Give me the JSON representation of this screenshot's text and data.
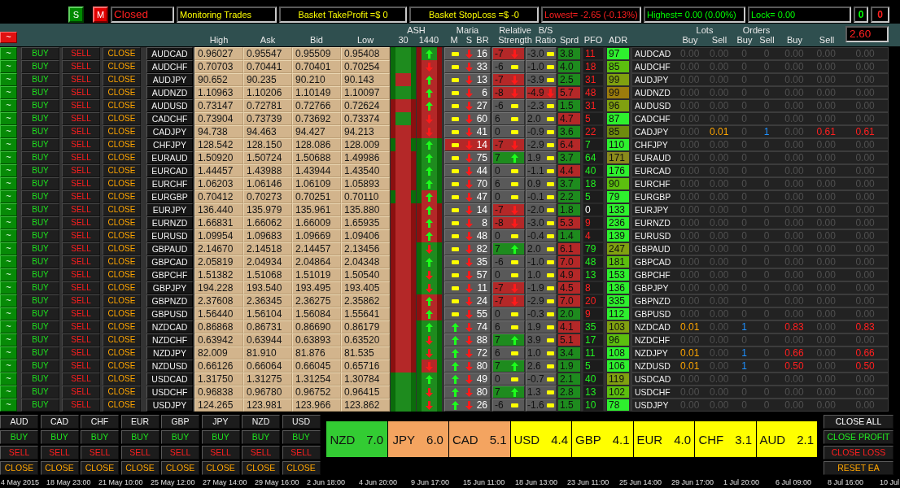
{
  "top_bar": {
    "buttons": [
      {
        "label": "S",
        "on": true
      },
      {
        "label": "M",
        "on": false
      }
    ],
    "fields": [
      {
        "text": "Closed",
        "color": "#ff2020"
      },
      {
        "text": "Monitoring Trades",
        "color": "#ffff00"
      },
      {
        "text": "Basket TakeProfit =$ 0",
        "color": "#ffff00"
      },
      {
        "text": "Basket StopLoss =$ -0",
        "color": "#ffff00"
      },
      {
        "text": "Lowest= -2.65 (-0.13%)",
        "color": "#ff2020"
      },
      {
        "text": "Highest= 0.00 (0.00%)",
        "color": "#00ff00"
      },
      {
        "text": "Lock= 0.00",
        "color": "#00ff00"
      },
      {
        "text": "0",
        "color": "#00ff00"
      },
      {
        "text": "0",
        "color": "#ff2020"
      }
    ]
  },
  "header": {
    "toggle": "~",
    "toggle_on": false,
    "columns": [
      {
        "label": "High"
      },
      {
        "label": "Ask"
      },
      {
        "label": "Bid"
      },
      {
        "label": "Low"
      },
      {
        "group": "ASH",
        "labels": [
          "30",
          "1440"
        ]
      },
      {
        "group": "Maria",
        "labels": [
          "M",
          "S",
          "BR"
        ]
      },
      {
        "group": "Relative",
        "labels": [
          "Strength"
        ]
      },
      {
        "group": "B/S",
        "labels": [
          "Ratio"
        ]
      },
      {
        "label": "Sprd"
      },
      {
        "label": "PFO"
      },
      {
        "label": "ADR"
      },
      {
        "group": "Lots",
        "labels": [
          "Buy",
          "Sell"
        ]
      },
      {
        "group": "Orders",
        "labels": [
          "Buy",
          "Sell"
        ]
      },
      {
        "label": "Buy"
      },
      {
        "label": "Sell"
      }
    ],
    "value": "2.60"
  },
  "rows": [
    {
      "toggle": "~",
      "toggle_on": true,
      "buy": "BUY",
      "sell": "SELL",
      "close": "CLOSE",
      "symbol": "AUDCAD",
      "high": "0.96027",
      "ask": "0.95547",
      "bid": "0.95509",
      "low": "0.95408",
      "ash_30": {
        "color": "#1e8b1e",
        "frame": {
          "color": "#0b6b0b"
        }
      },
      "ash_1440": {
        "color": "#1e8b1e",
        "up": true,
        "frame": {
          "color": "#8a1010"
        }
      },
      "maria": {
        "m_up": false,
        "s_up": false,
        "br": "16",
        "alert": false
      },
      "rs": {
        "value": "-7",
        "up": false,
        "down": true
      },
      "bs": {
        "value": "-3.0",
        "up": false,
        "down": false
      },
      "sprd": {
        "value": "3.8",
        "color": "#1e8b1e"
      },
      "pfo": {
        "value": "11",
        "color": "#ff2020"
      },
      "adr": {
        "value": "97",
        "color": "#2ef02e"
      },
      "trades": {
        "symbol": "AUDCAD",
        "cells": [
          "0.00",
          "0.00",
          "0",
          "0",
          "0.00",
          "0.00",
          "0.00"
        ],
        "buy_open": false,
        "sell_open": false
      }
    },
    {
      "toggle": "~",
      "toggle_on": true,
      "buy": "BUY",
      "sell": "SELL",
      "close": "CLOSE",
      "symbol": "AUDCHF",
      "high": "0.70703",
      "ask": "0.70441",
      "bid": "0.70401",
      "low": "0.70254",
      "ash_30": {
        "color": "#1e8b1e",
        "frame": {
          "color": "#0b6b0b"
        }
      },
      "ash_1440": {
        "color": "#b42828",
        "up": false,
        "frame": {
          "color": "#8a1010"
        }
      },
      "maria": {
        "m_up": false,
        "s_up": false,
        "br": "33",
        "alert": false
      },
      "rs": {
        "value": "-6",
        "up": false,
        "down": false
      },
      "bs": {
        "value": "-1.0",
        "up": false,
        "down": false
      },
      "sprd": {
        "value": "4.0",
        "color": "#1e8b1e"
      },
      "pfo": {
        "value": "18",
        "color": "#ff2020"
      },
      "adr": {
        "value": "85",
        "color": "#5cbf0f"
      },
      "trades": {
        "symbol": "AUDCHF",
        "cells": [
          "0.00",
          "0.00",
          "0",
          "0",
          "0.00",
          "0.00",
          "0.00"
        ],
        "buy_open": false,
        "sell_open": false
      }
    },
    {
      "toggle": "~",
      "toggle_on": true,
      "buy": "BUY",
      "sell": "SELL",
      "close": "CLOSE",
      "symbol": "AUDJPY",
      "high": "90.652",
      "ask": "90.235",
      "bid": "90.210",
      "low": "90.143",
      "ash_30": {
        "color": "#b42828",
        "frame": {
          "color": "#0b6b0b"
        }
      },
      "ash_1440": {
        "color": "#b42828",
        "up": true,
        "frame": {
          "color": "#8a1010"
        }
      },
      "maria": {
        "m_up": false,
        "s_up": false,
        "br": "13",
        "alert": false
      },
      "rs": {
        "value": "-7",
        "up": false,
        "down": true
      },
      "bs": {
        "value": "-3.9",
        "up": false,
        "down": false
      },
      "sprd": {
        "value": "2.5",
        "color": "#1e8b1e"
      },
      "pfo": {
        "value": "31",
        "color": "#ff2020"
      },
      "adr": {
        "value": "99",
        "color": "#80a010"
      },
      "trades": {
        "symbol": "AUDJPY",
        "cells": [
          "0.00",
          "0.00",
          "0",
          "0",
          "0.00",
          "0.00",
          "0.00"
        ],
        "buy_open": false,
        "sell_open": false
      }
    },
    {
      "toggle": "~",
      "toggle_on": true,
      "buy": "BUY",
      "sell": "SELL",
      "close": "CLOSE",
      "symbol": "AUDNZD",
      "high": "1.10963",
      "ask": "1.10206",
      "bid": "1.10149",
      "low": "1.10097",
      "ash_30": {
        "color": "#1e8b1e",
        "frame": {
          "color": "#0b6b0b"
        }
      },
      "ash_1440": {
        "color": "#b42828",
        "up": true,
        "frame": {
          "color": "#8a1010"
        }
      },
      "maria": {
        "m_up": false,
        "s_up": false,
        "br": "6",
        "alert": false
      },
      "rs": {
        "value": "-8",
        "up": false,
        "down": true
      },
      "bs": {
        "value": "-4.9",
        "up": false,
        "down": true
      },
      "sprd": {
        "value": "5.7",
        "color": "#b42828"
      },
      "pfo": {
        "value": "48",
        "color": "#ff2020"
      },
      "adr": {
        "value": "99",
        "color": "#9c7c0c"
      },
      "trades": {
        "symbol": "AUDNZD",
        "cells": [
          "0.00",
          "0.00",
          "0",
          "0",
          "0.00",
          "0.00",
          "0.00"
        ],
        "buy_open": false,
        "sell_open": false
      }
    },
    {
      "toggle": "~",
      "toggle_on": true,
      "buy": "BUY",
      "sell": "SELL",
      "close": "CLOSE",
      "symbol": "AUDUSD",
      "high": "0.73147",
      "ask": "0.72781",
      "bid": "0.72766",
      "low": "0.72624",
      "ash_30": {
        "color": "#b42828",
        "frame": {
          "color": "#8a1010"
        }
      },
      "ash_1440": {
        "color": "#b42828",
        "up": true,
        "frame": {
          "color": "#8a1010"
        }
      },
      "maria": {
        "m_up": false,
        "s_up": false,
        "br": "27",
        "alert": false
      },
      "rs": {
        "value": "-6",
        "up": false,
        "down": false
      },
      "bs": {
        "value": "-2.3",
        "up": false,
        "down": false
      },
      "sprd": {
        "value": "1.5",
        "color": "#1e8b1e"
      },
      "pfo": {
        "value": "31",
        "color": "#ff2020"
      },
      "adr": {
        "value": "96",
        "color": "#80a010"
      },
      "trades": {
        "symbol": "AUDUSD",
        "cells": [
          "0.00",
          "0.00",
          "0",
          "0",
          "0.00",
          "0.00",
          "0.00"
        ],
        "buy_open": false,
        "sell_open": false
      }
    },
    {
      "toggle": "~",
      "toggle_on": true,
      "buy": "BUY",
      "sell": "SELL",
      "close": "CLOSE",
      "symbol": "CADCHF",
      "high": "0.73904",
      "ask": "0.73739",
      "bid": "0.73692",
      "low": "0.73374",
      "ash_30": {
        "color": "#1e8b1e",
        "frame": {
          "color": "#8a1010"
        }
      },
      "ash_1440": {
        "color": "#b42828",
        "up": false,
        "frame": {
          "color": "#8a1010"
        }
      },
      "maria": {
        "m_up": false,
        "s_up": false,
        "br": "60",
        "alert": false
      },
      "rs": {
        "value": "6",
        "up": false,
        "down": false
      },
      "bs": {
        "value": "2.0",
        "up": false,
        "down": false
      },
      "sprd": {
        "value": "4.7",
        "color": "#b42828"
      },
      "pfo": {
        "value": "5",
        "color": "#ff2020"
      },
      "adr": {
        "value": "87",
        "color": "#2ef02e"
      },
      "trades": {
        "symbol": "CADCHF",
        "cells": [
          "0.00",
          "0.00",
          "0",
          "0",
          "0.00",
          "0.00",
          "0.00"
        ],
        "buy_open": false,
        "sell_open": false
      }
    },
    {
      "toggle": "~",
      "toggle_on": true,
      "buy": "BUY",
      "sell": "SELL",
      "close": "CLOSE",
      "symbol": "CADJPY",
      "high": "94.738",
      "ask": "94.463",
      "bid": "94.427",
      "low": "94.213",
      "ash_30": {
        "color": "#b42828",
        "frame": {
          "color": "#8a1010"
        }
      },
      "ash_1440": {
        "color": "#b42828",
        "up": false,
        "frame": {
          "color": "#8a1010"
        }
      },
      "maria": {
        "m_up": false,
        "s_up": false,
        "br": "41",
        "alert": false
      },
      "rs": {
        "value": "0",
        "up": false,
        "down": false
      },
      "bs": {
        "value": "-0.9",
        "up": false,
        "down": false
      },
      "sprd": {
        "value": "3.6",
        "color": "#1e8b1e"
      },
      "pfo": {
        "value": "22",
        "color": "#ff2020"
      },
      "adr": {
        "value": "85",
        "color": "#6e8c0e"
      },
      "trades": {
        "symbol": "CADJPY",
        "cells": [
          "0.00",
          "0.01",
          "0",
          "1",
          "0.00",
          "0.61",
          "0.61"
        ],
        "buy_open": false,
        "sell_open": true
      }
    },
    {
      "toggle": "~",
      "toggle_on": true,
      "buy": "BUY",
      "sell": "SELL",
      "close": "CLOSE",
      "symbol": "CHFJPY",
      "high": "128.542",
      "ask": "128.150",
      "bid": "128.086",
      "low": "128.009",
      "ash_30": {
        "color": "#b42828",
        "frame": {
          "color": "#0b6b0b"
        }
      },
      "ash_1440": {
        "color": "#1e8b1e",
        "up": true,
        "frame": {
          "color": "#0b6b0b"
        }
      },
      "maria": {
        "m_up": false,
        "s_up": false,
        "br": "14",
        "alert": true
      },
      "rs": {
        "value": "-7",
        "up": false,
        "down": true
      },
      "bs": {
        "value": "-2.9",
        "up": false,
        "down": false
      },
      "sprd": {
        "value": "6.4",
        "color": "#b42828"
      },
      "pfo": {
        "value": "7",
        "color": "#22ee22"
      },
      "adr": {
        "value": "110",
        "color": "#2ef02e"
      },
      "trades": {
        "symbol": "CHFJPY",
        "cells": [
          "0.00",
          "0.00",
          "0",
          "0",
          "0.00",
          "0.00",
          "0.00"
        ],
        "buy_open": false,
        "sell_open": false
      }
    },
    {
      "toggle": "~",
      "toggle_on": true,
      "buy": "BUY",
      "sell": "SELL",
      "close": "CLOSE",
      "symbol": "EURAUD",
      "high": "1.50920",
      "ask": "1.50724",
      "bid": "1.50688",
      "low": "1.49986",
      "ash_30": {
        "color": "#b42828",
        "frame": {
          "color": "#8a1010"
        }
      },
      "ash_1440": {
        "color": "#1e8b1e",
        "up": true,
        "frame": {
          "color": "#0b6b0b"
        }
      },
      "maria": {
        "m_up": false,
        "s_up": false,
        "br": "75",
        "alert": false
      },
      "rs": {
        "value": "7",
        "up": true,
        "down": false
      },
      "bs": {
        "value": "1.9",
        "up": false,
        "down": false
      },
      "sprd": {
        "value": "3.7",
        "color": "#1e8b1e"
      },
      "pfo": {
        "value": "64",
        "color": "#22ee22"
      },
      "adr": {
        "value": "171",
        "color": "#8a8a1c"
      },
      "trades": {
        "symbol": "EURAUD",
        "cells": [
          "0.00",
          "0.00",
          "0",
          "0",
          "0.00",
          "0.00",
          "0.00"
        ],
        "buy_open": false,
        "sell_open": false
      }
    },
    {
      "toggle": "~",
      "toggle_on": true,
      "buy": "BUY",
      "sell": "SELL",
      "close": "CLOSE",
      "symbol": "EURCAD",
      "high": "1.44457",
      "ask": "1.43988",
      "bid": "1.43944",
      "low": "1.43540",
      "ash_30": {
        "color": "#b42828",
        "frame": {
          "color": "#8a1010"
        }
      },
      "ash_1440": {
        "color": "#1e8b1e",
        "up": true,
        "frame": {
          "color": "#0b6b0b"
        }
      },
      "maria": {
        "m_up": false,
        "s_up": false,
        "br": "44",
        "alert": false
      },
      "rs": {
        "value": "0",
        "up": false,
        "down": false
      },
      "bs": {
        "value": "-1.1",
        "up": false,
        "down": false
      },
      "sprd": {
        "value": "4.4",
        "color": "#b42828"
      },
      "pfo": {
        "value": "40",
        "color": "#22ee22"
      },
      "adr": {
        "value": "176",
        "color": "#2ef02e"
      },
      "trades": {
        "symbol": "EURCAD",
        "cells": [
          "0.00",
          "0.00",
          "0",
          "0",
          "0.00",
          "0.00",
          "0.00"
        ],
        "buy_open": false,
        "sell_open": false
      }
    },
    {
      "toggle": "~",
      "toggle_on": true,
      "buy": "BUY",
      "sell": "SELL",
      "close": "CLOSE",
      "symbol": "EURCHF",
      "high": "1.06203",
      "ask": "1.06146",
      "bid": "1.06109",
      "low": "1.05893",
      "ash_30": {
        "color": "#b42828",
        "frame": {
          "color": "#8a1010"
        }
      },
      "ash_1440": {
        "color": "#1e8b1e",
        "up": true,
        "frame": {
          "color": "#0b6b0b"
        }
      },
      "maria": {
        "m_up": false,
        "s_up": false,
        "br": "70",
        "alert": false
      },
      "rs": {
        "value": "6",
        "up": false,
        "down": false
      },
      "bs": {
        "value": "0.9",
        "up": false,
        "down": false
      },
      "sprd": {
        "value": "3.7",
        "color": "#1e8b1e"
      },
      "pfo": {
        "value": "18",
        "color": "#22ee22"
      },
      "adr": {
        "value": "90",
        "color": "#5cbf0f"
      },
      "trades": {
        "symbol": "EURCHF",
        "cells": [
          "0.00",
          "0.00",
          "0",
          "0",
          "0.00",
          "0.00",
          "0.00"
        ],
        "buy_open": false,
        "sell_open": false
      }
    },
    {
      "toggle": "~",
      "toggle_on": true,
      "buy": "BUY",
      "sell": "SELL",
      "close": "CLOSE",
      "symbol": "EURGBP",
      "high": "0.70412",
      "ask": "0.70273",
      "bid": "0.70251",
      "low": "0.70110",
      "ash_30": {
        "color": "#b42828",
        "frame": {
          "color": "#0b6b0b"
        }
      },
      "ash_1440": {
        "color": "#b42828",
        "up": true,
        "frame": {
          "color": "#0b6b0b"
        }
      },
      "maria": {
        "m_up": false,
        "s_up": false,
        "br": "47",
        "alert": false
      },
      "rs": {
        "value": "0",
        "up": false,
        "down": false
      },
      "bs": {
        "value": "-0.1",
        "up": false,
        "down": false
      },
      "sprd": {
        "value": "2.2",
        "color": "#1e8b1e"
      },
      "pfo": {
        "value": "5",
        "color": "#22ee22"
      },
      "adr": {
        "value": "79",
        "color": "#2ef02e"
      },
      "trades": {
        "symbol": "EURGBP",
        "cells": [
          "0.00",
          "0.00",
          "0",
          "0",
          "0.00",
          "0.00",
          "0.00"
        ],
        "buy_open": false,
        "sell_open": false
      }
    },
    {
      "toggle": "~",
      "toggle_on": true,
      "buy": "BUY",
      "sell": "SELL",
      "close": "CLOSE",
      "symbol": "EURJPY",
      "high": "136.440",
      "ask": "135.979",
      "bid": "135.961",
      "low": "135.880",
      "ash_30": {
        "color": "#b42828",
        "frame": {
          "color": "#8a1010"
        }
      },
      "ash_1440": {
        "color": "#b42828",
        "up": true,
        "frame": {
          "color": "#8a1010"
        }
      },
      "maria": {
        "m_up": false,
        "s_up": false,
        "br": "14",
        "alert": false
      },
      "rs": {
        "value": "-7",
        "up": false,
        "down": true
      },
      "bs": {
        "value": "-2.0",
        "up": false,
        "down": false
      },
      "sprd": {
        "value": "1.8",
        "color": "#1e8b1e"
      },
      "pfo": {
        "value": "0",
        "color": "#ffffff"
      },
      "adr": {
        "value": "133",
        "color": "#2ef02e"
      },
      "trades": {
        "symbol": "EURJPY",
        "cells": [
          "0.00",
          "0.00",
          "0",
          "0",
          "0.00",
          "0.00",
          "0.00"
        ],
        "buy_open": false,
        "sell_open": false
      }
    },
    {
      "toggle": "~",
      "toggle_on": true,
      "buy": "BUY",
      "sell": "SELL",
      "close": "CLOSE",
      "symbol": "EURNZD",
      "high": "1.66831",
      "ask": "1.66062",
      "bid": "1.66009",
      "low": "1.65935",
      "ash_30": {
        "color": "#b42828",
        "frame": {
          "color": "#8a1010"
        }
      },
      "ash_1440": {
        "color": "#b42828",
        "up": true,
        "frame": {
          "color": "#8a1010"
        }
      },
      "maria": {
        "m_up": false,
        "s_up": false,
        "br": "8",
        "alert": false
      },
      "rs": {
        "value": "-8",
        "up": false,
        "down": true
      },
      "bs": {
        "value": "-3.0",
        "up": false,
        "down": false
      },
      "sprd": {
        "value": "5.3",
        "color": "#b42828"
      },
      "pfo": {
        "value": "9",
        "color": "#ff2020"
      },
      "adr": {
        "value": "236",
        "color": "#2ef02e"
      },
      "trades": {
        "symbol": "EURNZD",
        "cells": [
          "0.00",
          "0.00",
          "0",
          "0",
          "0.00",
          "0.00",
          "0.00"
        ],
        "buy_open": false,
        "sell_open": false
      }
    },
    {
      "toggle": "~",
      "toggle_on": true,
      "buy": "BUY",
      "sell": "SELL",
      "close": "CLOSE",
      "symbol": "EURUSD",
      "high": "1.09954",
      "ask": "1.09683",
      "bid": "1.09669",
      "low": "1.09406",
      "ash_30": {
        "color": "#b42828",
        "frame": {
          "color": "#8a1010"
        }
      },
      "ash_1440": {
        "color": "#b42828",
        "up": true,
        "frame": {
          "color": "#8a1010"
        }
      },
      "maria": {
        "m_up": false,
        "s_up": false,
        "br": "48",
        "alert": false
      },
      "rs": {
        "value": "0",
        "up": false,
        "down": false
      },
      "bs": {
        "value": "-0.4",
        "up": false,
        "down": false
      },
      "sprd": {
        "value": "1.4",
        "color": "#1e8b1e"
      },
      "pfo": {
        "value": "4",
        "color": "#ff2020"
      },
      "adr": {
        "value": "139",
        "color": "#2ef02e"
      },
      "trades": {
        "symbol": "EURUSD",
        "cells": [
          "0.00",
          "0.00",
          "0",
          "0",
          "0.00",
          "0.00",
          "0.00"
        ],
        "buy_open": false,
        "sell_open": false
      }
    },
    {
      "toggle": "~",
      "toggle_on": true,
      "buy": "BUY",
      "sell": "SELL",
      "close": "CLOSE",
      "symbol": "GBPAUD",
      "high": "2.14670",
      "ask": "2.14518",
      "bid": "2.14457",
      "low": "2.13456",
      "ash_30": {
        "color": "#b42828",
        "frame": {
          "color": "#8a1010"
        }
      },
      "ash_1440": {
        "color": "#1e8b1e",
        "up": false,
        "frame": {
          "color": "#0b6b0b"
        }
      },
      "maria": {
        "m_up": false,
        "s_up": false,
        "br": "82",
        "alert": false
      },
      "rs": {
        "value": "7",
        "up": true,
        "down": false
      },
      "bs": {
        "value": "2.0",
        "up": false,
        "down": false
      },
      "sprd": {
        "value": "6.1",
        "color": "#b42828"
      },
      "pfo": {
        "value": "79",
        "color": "#22ee22"
      },
      "adr": {
        "value": "247",
        "color": "#80a010"
      },
      "trades": {
        "symbol": "GBPAUD",
        "cells": [
          "0.00",
          "0.00",
          "0",
          "0",
          "0.00",
          "0.00",
          "0.00"
        ],
        "buy_open": false,
        "sell_open": false
      }
    },
    {
      "toggle": "~",
      "toggle_on": true,
      "buy": "BUY",
      "sell": "SELL",
      "close": "CLOSE",
      "symbol": "GBPCAD",
      "high": "2.05819",
      "ask": "2.04934",
      "bid": "2.04864",
      "low": "2.04348",
      "ash_30": {
        "color": "#b42828",
        "frame": {
          "color": "#8a1010"
        }
      },
      "ash_1440": {
        "color": "#1e8b1e",
        "up": true,
        "frame": {
          "color": "#0b6b0b"
        }
      },
      "maria": {
        "m_up": false,
        "s_up": false,
        "br": "35",
        "alert": false
      },
      "rs": {
        "value": "-6",
        "up": false,
        "down": false
      },
      "bs": {
        "value": "-1.0",
        "up": false,
        "down": false
      },
      "sprd": {
        "value": "7.0",
        "color": "#b42828"
      },
      "pfo": {
        "value": "48",
        "color": "#22ee22"
      },
      "adr": {
        "value": "181",
        "color": "#5cbf0f"
      },
      "trades": {
        "symbol": "GBPCAD",
        "cells": [
          "0.00",
          "0.00",
          "0",
          "0",
          "0.00",
          "0.00",
          "0.00"
        ],
        "buy_open": false,
        "sell_open": false
      }
    },
    {
      "toggle": "~",
      "toggle_on": true,
      "buy": "BUY",
      "sell": "SELL",
      "close": "CLOSE",
      "symbol": "GBPCHF",
      "high": "1.51382",
      "ask": "1.51068",
      "bid": "1.51019",
      "low": "1.50540",
      "ash_30": {
        "color": "#b42828",
        "frame": {
          "color": "#8a1010"
        }
      },
      "ash_1440": {
        "color": "#1e8b1e",
        "up": false,
        "frame": {
          "color": "#0b6b0b"
        }
      },
      "maria": {
        "m_up": false,
        "s_up": false,
        "br": "57",
        "alert": false
      },
      "rs": {
        "value": "0",
        "up": false,
        "down": false
      },
      "bs": {
        "value": "1.0",
        "up": false,
        "down": false
      },
      "sprd": {
        "value": "4.9",
        "color": "#b42828"
      },
      "pfo": {
        "value": "13",
        "color": "#22ee22"
      },
      "adr": {
        "value": "153",
        "color": "#2ef02e"
      },
      "trades": {
        "symbol": "GBPCHF",
        "cells": [
          "0.00",
          "0.00",
          "0",
          "0",
          "0.00",
          "0.00",
          "0.00"
        ],
        "buy_open": false,
        "sell_open": false
      }
    },
    {
      "toggle": "~",
      "toggle_on": true,
      "buy": "BUY",
      "sell": "SELL",
      "close": "CLOSE",
      "symbol": "GBPJPY",
      "high": "194.228",
      "ask": "193.540",
      "bid": "193.495",
      "low": "193.405",
      "ash_30": {
        "color": "#b42828",
        "frame": {
          "color": "#8a1010"
        }
      },
      "ash_1440": {
        "color": "#1e8b1e",
        "up": false,
        "frame": {
          "color": "#0b6b0b"
        }
      },
      "maria": {
        "m_up": false,
        "s_up": false,
        "br": "11",
        "alert": false
      },
      "rs": {
        "value": "-7",
        "up": false,
        "down": true
      },
      "bs": {
        "value": "-1.9",
        "up": false,
        "down": false
      },
      "sprd": {
        "value": "4.5",
        "color": "#b42828"
      },
      "pfo": {
        "value": "8",
        "color": "#ff2020"
      },
      "adr": {
        "value": "136",
        "color": "#2ef02e"
      },
      "trades": {
        "symbol": "GBPJPY",
        "cells": [
          "0.00",
          "0.00",
          "0",
          "0",
          "0.00",
          "0.00",
          "0.00"
        ],
        "buy_open": false,
        "sell_open": false
      }
    },
    {
      "toggle": "~",
      "toggle_on": true,
      "buy": "BUY",
      "sell": "SELL",
      "close": "CLOSE",
      "symbol": "GBPNZD",
      "high": "2.37608",
      "ask": "2.36345",
      "bid": "2.36275",
      "low": "2.35862",
      "ash_30": {
        "color": "#b42828",
        "frame": {
          "color": "#8a1010"
        }
      },
      "ash_1440": {
        "color": "#b42828",
        "up": true,
        "frame": {
          "color": "#8a1010"
        }
      },
      "maria": {
        "m_up": false,
        "s_up": false,
        "br": "24",
        "alert": false
      },
      "rs": {
        "value": "-7",
        "up": false,
        "down": true
      },
      "bs": {
        "value": "-2.9",
        "up": false,
        "down": false
      },
      "sprd": {
        "value": "7.0",
        "color": "#b42828"
      },
      "pfo": {
        "value": "20",
        "color": "#ff2020"
      },
      "adr": {
        "value": "335",
        "color": "#2ef02e"
      },
      "trades": {
        "symbol": "GBPNZD",
        "cells": [
          "0.00",
          "0.00",
          "0",
          "0",
          "0.00",
          "0.00",
          "0.00"
        ],
        "buy_open": false,
        "sell_open": false
      }
    },
    {
      "toggle": "~",
      "toggle_on": true,
      "buy": "BUY",
      "sell": "SELL",
      "close": "CLOSE",
      "symbol": "GBPUSD",
      "high": "1.56440",
      "ask": "1.56104",
      "bid": "1.56084",
      "low": "1.55641",
      "ash_30": {
        "color": "#b42828",
        "frame": {
          "color": "#8a1010"
        }
      },
      "ash_1440": {
        "color": "#b42828",
        "up": true,
        "frame": {
          "color": "#8a1010"
        }
      },
      "maria": {
        "m_up": false,
        "s_up": false,
        "br": "55",
        "alert": false
      },
      "rs": {
        "value": "0",
        "up": false,
        "down": false
      },
      "bs": {
        "value": "-0.3",
        "up": false,
        "down": false
      },
      "sprd": {
        "value": "2.0",
        "color": "#1e8b1e"
      },
      "pfo": {
        "value": "9",
        "color": "#ff2020"
      },
      "adr": {
        "value": "112",
        "color": "#2ef02e"
      },
      "trades": {
        "symbol": "GBPUSD",
        "cells": [
          "0.00",
          "0.00",
          "0",
          "0",
          "0.00",
          "0.00",
          "0.00"
        ],
        "buy_open": false,
        "sell_open": false
      }
    },
    {
      "toggle": "~",
      "toggle_on": true,
      "buy": "BUY",
      "sell": "SELL",
      "close": "CLOSE",
      "symbol": "NZDCAD",
      "high": "0.86868",
      "ask": "0.86731",
      "bid": "0.86690",
      "low": "0.86179",
      "ash_30": {
        "color": "#b42828",
        "frame": {
          "color": "#8a1010"
        }
      },
      "ash_1440": {
        "color": "#1e8b1e",
        "up": true,
        "frame": {
          "color": "#0b6b0b"
        }
      },
      "maria": {
        "m_up": true,
        "s_up": false,
        "br": "74",
        "alert": false
      },
      "rs": {
        "value": "6",
        "up": false,
        "down": false
      },
      "bs": {
        "value": "1.9",
        "up": false,
        "down": false
      },
      "sprd": {
        "value": "4.1",
        "color": "#b42828"
      },
      "pfo": {
        "value": "35",
        "color": "#22ee22"
      },
      "adr": {
        "value": "103",
        "color": "#80a010"
      },
      "trades": {
        "symbol": "NZDCAD",
        "cells": [
          "0.01",
          "0.00",
          "1",
          "0",
          "0.83",
          "0.00",
          "0.83"
        ],
        "buy_open": true,
        "sell_open": false
      }
    },
    {
      "toggle": "~",
      "toggle_on": true,
      "buy": "BUY",
      "sell": "SELL",
      "close": "CLOSE",
      "symbol": "NZDCHF",
      "high": "0.63942",
      "ask": "0.63944",
      "bid": "0.63893",
      "low": "0.63520",
      "ash_30": {
        "color": "#b42828",
        "frame": {
          "color": "#8a1010"
        }
      },
      "ash_1440": {
        "color": "#1e8b1e",
        "up": false,
        "frame": {
          "color": "#0b6b0b"
        }
      },
      "maria": {
        "m_up": true,
        "s_up": false,
        "br": "88",
        "alert": false
      },
      "rs": {
        "value": "7",
        "up": true,
        "down": false
      },
      "bs": {
        "value": "3.9",
        "up": false,
        "down": false
      },
      "sprd": {
        "value": "5.1",
        "color": "#b42828"
      },
      "pfo": {
        "value": "17",
        "color": "#22ee22"
      },
      "adr": {
        "value": "96",
        "color": "#5cbf0f"
      },
      "trades": {
        "symbol": "NZDCHF",
        "cells": [
          "0.00",
          "0.00",
          "0",
          "0",
          "0.00",
          "0.00",
          "0.00"
        ],
        "buy_open": false,
        "sell_open": false
      }
    },
    {
      "toggle": "~",
      "toggle_on": true,
      "buy": "BUY",
      "sell": "SELL",
      "close": "CLOSE",
      "symbol": "NZDJPY",
      "high": "82.009",
      "ask": "81.910",
      "bid": "81.876",
      "low": "81.535",
      "ash_30": {
        "color": "#b42828",
        "frame": {
          "color": "#8a1010"
        }
      },
      "ash_1440": {
        "color": "#1e8b1e",
        "up": false,
        "frame": {
          "color": "#0b6b0b"
        }
      },
      "maria": {
        "m_up": true,
        "s_up": false,
        "br": "72",
        "alert": false
      },
      "rs": {
        "value": "6",
        "up": false,
        "down": false
      },
      "bs": {
        "value": "1.0",
        "up": false,
        "down": false
      },
      "sprd": {
        "value": "3.4",
        "color": "#1e8b1e"
      },
      "pfo": {
        "value": "11",
        "color": "#22ee22"
      },
      "adr": {
        "value": "108",
        "color": "#2ef02e"
      },
      "trades": {
        "symbol": "NZDJPY",
        "cells": [
          "0.01",
          "0.00",
          "1",
          "0",
          "0.66",
          "0.00",
          "0.66"
        ],
        "buy_open": true,
        "sell_open": false
      }
    },
    {
      "toggle": "~",
      "toggle_on": true,
      "buy": "BUY",
      "sell": "SELL",
      "close": "CLOSE",
      "symbol": "NZDUSD",
      "high": "0.66126",
      "ask": "0.66064",
      "bid": "0.66045",
      "low": "0.65716",
      "ash_30": {
        "color": "#b42828",
        "frame": {
          "color": "#8a1010"
        }
      },
      "ash_1440": {
        "color": "#b42828",
        "up": false,
        "frame": {
          "color": "#0b6b0b"
        }
      },
      "maria": {
        "m_up": true,
        "s_up": false,
        "br": "80",
        "alert": false
      },
      "rs": {
        "value": "7",
        "up": true,
        "down": false
      },
      "bs": {
        "value": "2.6",
        "up": false,
        "down": false
      },
      "sprd": {
        "value": "1.9",
        "color": "#1e8b1e"
      },
      "pfo": {
        "value": "5",
        "color": "#22ee22"
      },
      "adr": {
        "value": "106",
        "color": "#2ef02e"
      },
      "trades": {
        "symbol": "NZDUSD",
        "cells": [
          "0.01",
          "0.00",
          "1",
          "0",
          "0.50",
          "0.00",
          "0.50"
        ],
        "buy_open": true,
        "sell_open": false
      }
    },
    {
      "toggle": "~",
      "toggle_on": true,
      "buy": "BUY",
      "sell": "SELL",
      "close": "CLOSE",
      "symbol": "USDCAD",
      "high": "1.31750",
      "ask": "1.31275",
      "bid": "1.31254",
      "low": "1.30784",
      "ash_30": {
        "color": "#1e8b1e",
        "frame": {
          "color": "#0b6b0b"
        }
      },
      "ash_1440": {
        "color": "#1e8b1e",
        "up": true,
        "frame": {
          "color": "#0b6b0b"
        }
      },
      "maria": {
        "m_up": true,
        "s_up": false,
        "br": "49",
        "alert": false
      },
      "rs": {
        "value": "0",
        "up": false,
        "down": false
      },
      "bs": {
        "value": "-0.7",
        "up": false,
        "down": false
      },
      "sprd": {
        "value": "2.1",
        "color": "#1e8b1e"
      },
      "pfo": {
        "value": "40",
        "color": "#22ee22"
      },
      "adr": {
        "value": "119",
        "color": "#80a010"
      },
      "trades": {
        "symbol": "USDCAD",
        "cells": [
          "0.00",
          "0.00",
          "0",
          "0",
          "0.00",
          "0.00",
          "0.00"
        ],
        "buy_open": false,
        "sell_open": false
      }
    },
    {
      "toggle": "~",
      "toggle_on": true,
      "buy": "BUY",
      "sell": "SELL",
      "close": "CLOSE",
      "symbol": "USDCHF",
      "high": "0.96838",
      "ask": "0.96780",
      "bid": "0.96752",
      "low": "0.96415",
      "ash_30": {
        "color": "#1e8b1e",
        "frame": {
          "color": "#0b6b0b"
        }
      },
      "ash_1440": {
        "color": "#1e8b1e",
        "up": false,
        "frame": {
          "color": "#0b6b0b"
        }
      },
      "maria": {
        "m_up": true,
        "s_up": false,
        "br": "80",
        "alert": false
      },
      "rs": {
        "value": "7",
        "up": true,
        "down": false
      },
      "bs": {
        "value": "1.3",
        "up": false,
        "down": false
      },
      "sprd": {
        "value": "2.8",
        "color": "#1e8b1e"
      },
      "pfo": {
        "value": "13",
        "color": "#22ee22"
      },
      "adr": {
        "value": "102",
        "color": "#5cbf0f"
      },
      "trades": {
        "symbol": "USDCHF",
        "cells": [
          "0.00",
          "0.00",
          "0",
          "0",
          "0.00",
          "0.00",
          "0.00"
        ],
        "buy_open": false,
        "sell_open": false
      }
    },
    {
      "toggle": "~",
      "toggle_on": true,
      "buy": "BUY",
      "sell": "SELL",
      "close": "CLOSE",
      "symbol": "USDJPY",
      "high": "124.265",
      "ask": "123.981",
      "bid": "123.966",
      "low": "123.862",
      "ash_30": {
        "color": "#1e8b1e",
        "frame": {
          "color": "#0b6b0b"
        }
      },
      "ash_1440": {
        "color": "#1e8b1e",
        "up": false,
        "frame": {
          "color": "#0b6b0b"
        }
      },
      "maria": {
        "m_up": true,
        "s_up": false,
        "br": "26",
        "alert": false
      },
      "rs": {
        "value": "-6",
        "up": false,
        "down": false
      },
      "bs": {
        "value": "-1.6",
        "up": false,
        "down": false
      },
      "sprd": {
        "value": "1.5",
        "color": "#1e8b1e"
      },
      "pfo": {
        "value": "10",
        "color": "#22ee22"
      },
      "adr": {
        "value": "78",
        "color": "#2ef02e"
      },
      "trades": {
        "symbol": "USDJPY",
        "cells": [
          "0.00",
          "0.00",
          "0",
          "0",
          "0.00",
          "0.00",
          "0.00"
        ],
        "buy_open": false,
        "sell_open": false
      }
    }
  ],
  "currency_panel": [
    {
      "currency": "AUD",
      "buy": "BUY",
      "sell": "SELL",
      "close": "CLOSE"
    },
    {
      "currency": "CAD",
      "buy": "BUY",
      "sell": "SELL",
      "close": "CLOSE"
    },
    {
      "currency": "CHF",
      "buy": "BUY",
      "sell": "SELL",
      "close": "CLOSE"
    },
    {
      "currency": "EUR",
      "buy": "BUY",
      "sell": "SELL",
      "close": "CLOSE"
    },
    {
      "currency": "GBP",
      "buy": "BUY",
      "sell": "SELL",
      "close": "CLOSE"
    },
    {
      "currency": "JPY",
      "buy": "BUY",
      "sell": "SELL",
      "close": "CLOSE"
    },
    {
      "currency": "NZD",
      "buy": "BUY",
      "sell": "SELL",
      "close": "CLOSE"
    },
    {
      "currency": "USD",
      "buy": "BUY",
      "sell": "SELL",
      "close": "CLOSE"
    }
  ],
  "strength": [
    {
      "currency": "NZD",
      "value": "7.0",
      "color": "#33cc33"
    },
    {
      "currency": "JPY",
      "value": "6.0",
      "color": "#f4a460"
    },
    {
      "currency": "CAD",
      "value": "5.1",
      "color": "#f4a460"
    },
    {
      "currency": "USD",
      "value": "4.4",
      "color": "#ffff00"
    },
    {
      "currency": "GBP",
      "value": "4.1",
      "color": "#ffff00"
    },
    {
      "currency": "EUR",
      "value": "4.0",
      "color": "#ffff00"
    },
    {
      "currency": "CHF",
      "value": "3.1",
      "color": "#ffff00"
    },
    {
      "currency": "AUD",
      "value": "2.1",
      "color": "#ffff00"
    }
  ],
  "actions": [
    {
      "label": "CLOSE ALL",
      "color": "#ffffff"
    },
    {
      "label": "CLOSE PROFIT",
      "color": "#22ee22"
    },
    {
      "label": "CLOSE LOSS",
      "color": "#ff2020"
    },
    {
      "label": "RESET EA",
      "color": "#ffa500"
    }
  ],
  "time_axis": {
    "labels": [
      "4 May 2015",
      "18 May 23:00",
      "21 May 10:00",
      "25 May 12:00",
      "27 May 14:00",
      "29 May 16:00",
      "2 Jun 18:00",
      "4 Jun 20:00",
      "9 Jun 17:00",
      "15 Jun 11:00",
      "18 Jun 13:00",
      "23 Jun 11:00",
      "25 Jun 14:00",
      "29 Jun 17:00",
      "1 Jul 20:00",
      "6 Jul 09:00",
      "8 Jul 16:00",
      "10 Jul"
    ]
  }
}
